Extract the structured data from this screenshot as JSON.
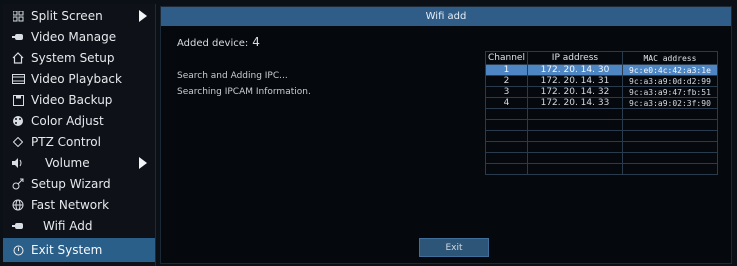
{
  "menu": {
    "items": [
      {
        "label": "Split Screen",
        "icon": "grid-icon",
        "submenu": true
      },
      {
        "label": "Video Manage",
        "icon": "camera-icon"
      },
      {
        "label": "System Setup",
        "icon": "home-icon"
      },
      {
        "label": "Video Playback",
        "icon": "playback-icon"
      },
      {
        "label": "Video Backup",
        "icon": "floppy-icon"
      },
      {
        "label": "Color Adjust",
        "icon": "palette-icon"
      },
      {
        "label": "PTZ Control",
        "icon": "ptz-icon"
      },
      {
        "label": "Volume",
        "icon": "speaker-icon",
        "submenu": true
      },
      {
        "label": "Setup Wizard",
        "icon": "wizard-icon"
      },
      {
        "label": "Fast Network",
        "icon": "network-icon"
      },
      {
        "label": "Wifi Add",
        "icon": "camera-icon"
      },
      {
        "label": "Exit System",
        "icon": "power-icon",
        "selected": true
      }
    ]
  },
  "dialog": {
    "title": "Wifi add",
    "added_label": "Added device:",
    "added_count": "4",
    "status_lines": [
      "Search and Adding IPC...",
      "Searching IPCAM Information."
    ],
    "table": {
      "headers": [
        "Channel",
        "IP address",
        "MAC address"
      ],
      "rows": [
        {
          "channel": "1",
          "ip": "172. 20. 14. 30",
          "mac": "9c:e0:4c:42:a3:1e",
          "selected": true
        },
        {
          "channel": "2",
          "ip": "172. 20. 14. 31",
          "mac": "9c:a3:a9:0d:d2:99"
        },
        {
          "channel": "3",
          "ip": "172. 20. 14. 32",
          "mac": "9c:a3:a9:47:fb:51"
        },
        {
          "channel": "4",
          "ip": "172. 20. 14. 33",
          "mac": "9c:a3:a9:02:3f:90"
        },
        {
          "channel": "",
          "ip": "",
          "mac": ""
        },
        {
          "channel": "",
          "ip": "",
          "mac": ""
        },
        {
          "channel": "",
          "ip": "",
          "mac": ""
        },
        {
          "channel": "",
          "ip": "",
          "mac": ""
        },
        {
          "channel": "",
          "ip": "",
          "mac": ""
        },
        {
          "channel": "",
          "ip": "",
          "mac": ""
        }
      ]
    },
    "exit_label": "Exit"
  },
  "colors": {
    "titlebar": "#2f5d87",
    "selected_row": "#4e86c4",
    "menu_selected": "#2a5f8a"
  }
}
